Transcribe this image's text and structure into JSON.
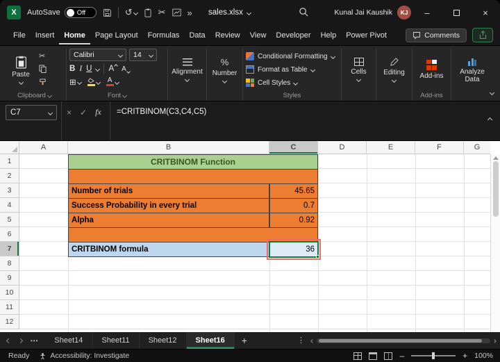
{
  "icons": {
    "undo": "↺",
    "scissors": "✂",
    "more_commands": "»",
    "minimize": "–",
    "close": "×",
    "cancel": "×",
    "check": "✓",
    "fx": "fx",
    "percent": "%",
    "bold": "B",
    "italic": "I",
    "underline": "U",
    "grow_font": "A",
    "shrink_font": "A",
    "font_color": "A",
    "borders": "⊞",
    "tab_ellipsis": "•••",
    "add_sheet": "+",
    "kebab": "⋮",
    "logo_letter": "X"
  },
  "titlebar": {
    "autosave_label": "AutoSave",
    "autosave_state": "Off",
    "filename": "sales.xlsx",
    "user_name": "Kunal Jai Kaushik",
    "user_initials": "KJ"
  },
  "menubar": {
    "tabs": [
      "File",
      "Insert",
      "Home",
      "Page Layout",
      "Formulas",
      "Data",
      "Review",
      "View",
      "Developer",
      "Help",
      "Power Pivot"
    ],
    "active_tab": "Home",
    "comments_label": "Comments"
  },
  "ribbon": {
    "paste": "Paste",
    "clipboard_group": "Clipboard",
    "font_name": "Calibri",
    "font_size": "14",
    "font_group": "Font",
    "alignment": "Alignment",
    "number": "Number",
    "conditional_formatting": "Conditional Formatting",
    "format_as_table": "Format as Table",
    "cell_styles": "Cell Styles",
    "styles_group": "Styles",
    "cells": "Cells",
    "editing": "Editing",
    "addins": "Add-ins",
    "addins_group": "Add-ins",
    "analyze_data": "Analyze Data"
  },
  "formula_bar": {
    "name_box": "C7",
    "formula": "=CRITBINOM(C3,C4,C5)"
  },
  "grid": {
    "columns": [
      "A",
      "B",
      "C",
      "D",
      "E",
      "F",
      "G"
    ],
    "rows": [
      "1",
      "2",
      "3",
      "4",
      "5",
      "6",
      "7",
      "8",
      "9",
      "10",
      "11",
      "12"
    ]
  },
  "sheet": {
    "title": "CRITBINOM Function",
    "items": [
      {
        "label": "Number of trials",
        "value": "45.65"
      },
      {
        "label": "Success Probability in every trial",
        "value": "0.7"
      },
      {
        "label": "Alpha",
        "value": "0.92"
      }
    ],
    "formula_label": "CRITBINOM formula",
    "result": "36"
  },
  "tabbar": {
    "tabs": [
      "Sheet14",
      "Sheet11",
      "Sheet12",
      "Sheet16"
    ],
    "active_tab": "Sheet16"
  },
  "statusbar": {
    "mode": "Ready",
    "accessibility": "Accessibility: Investigate",
    "zoom": "100%"
  },
  "colors": {
    "excel_green": "#107C41",
    "table_orange": "#ED7D31",
    "header_green": "#A9D08E",
    "label_blue": "#BDD7EE",
    "result_fill": "#DDEBF7",
    "annotation_red": "#F16B6B",
    "tab_underline_green": "#21A366"
  }
}
